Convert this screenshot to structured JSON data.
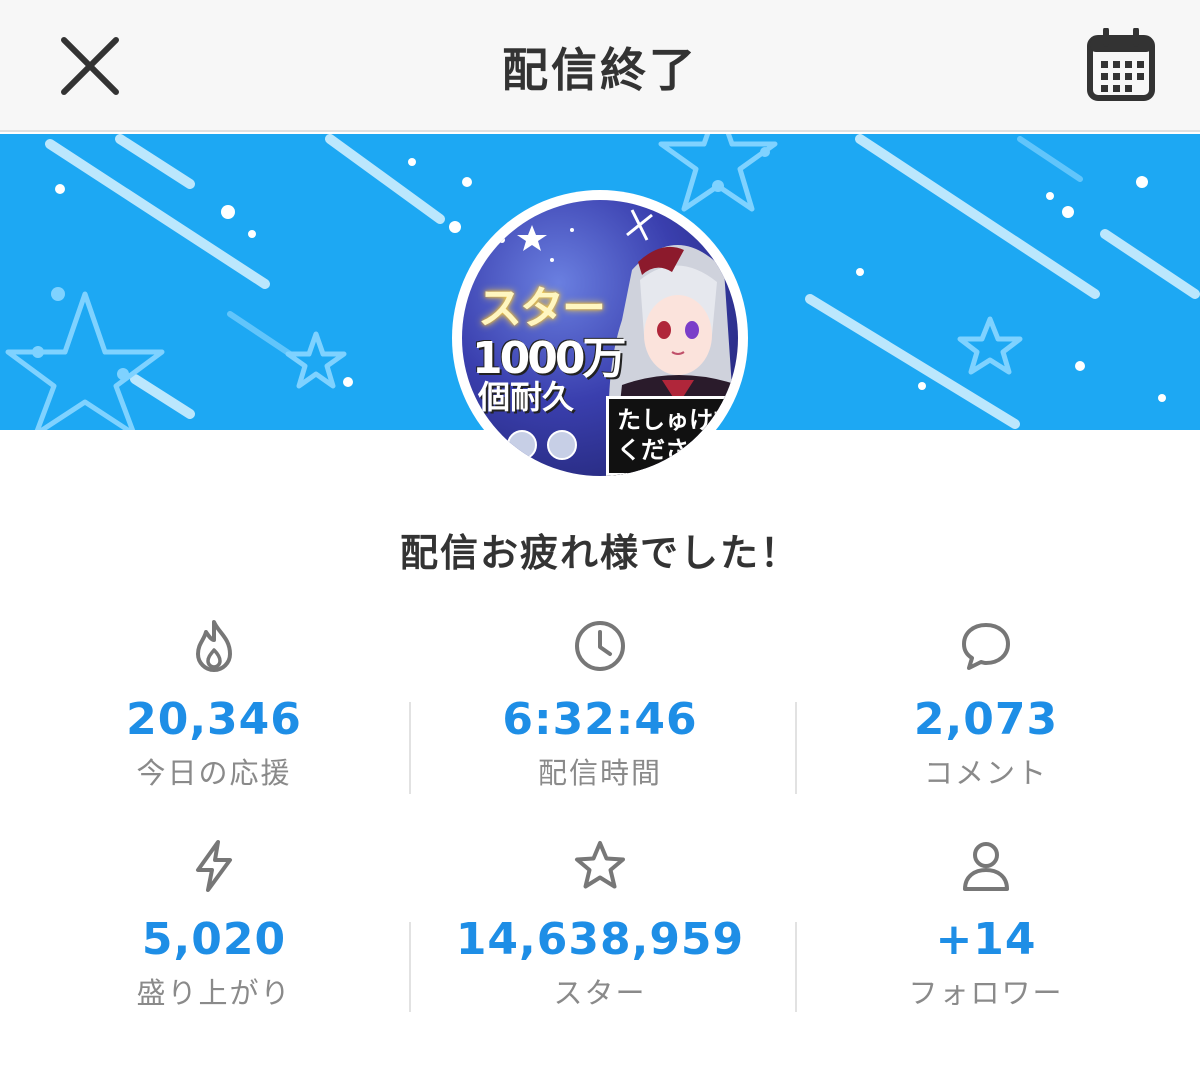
{
  "header": {
    "title": "配信終了",
    "close_icon": "close-icon",
    "calendar_icon": "calendar-icon"
  },
  "avatar": {
    "overlay_text_1": "スター",
    "overlay_text_2": "1000万",
    "overlay_text_3": "個耐久",
    "overlay_box_text": "たしゅけて\nくださ"
  },
  "greeting": "配信お疲れ様でした！",
  "stats": [
    {
      "icon": "fire-icon",
      "value": "20,346",
      "label": "今日の応援"
    },
    {
      "icon": "clock-icon",
      "value": "6:32:46",
      "label": "配信時間"
    },
    {
      "icon": "comment-icon",
      "value": "2,073",
      "label": "コメント"
    },
    {
      "icon": "lightning-icon",
      "value": "5,020",
      "label": "盛り上がり"
    },
    {
      "icon": "star-icon",
      "value": "14,638,959",
      "label": "スター"
    },
    {
      "icon": "person-icon",
      "value": "+14",
      "label": "フォロワー"
    }
  ],
  "colors": {
    "accent": "#1e8ee6",
    "banner": "#1da8f3",
    "label": "#8a8a8a",
    "icon": "#777777"
  }
}
